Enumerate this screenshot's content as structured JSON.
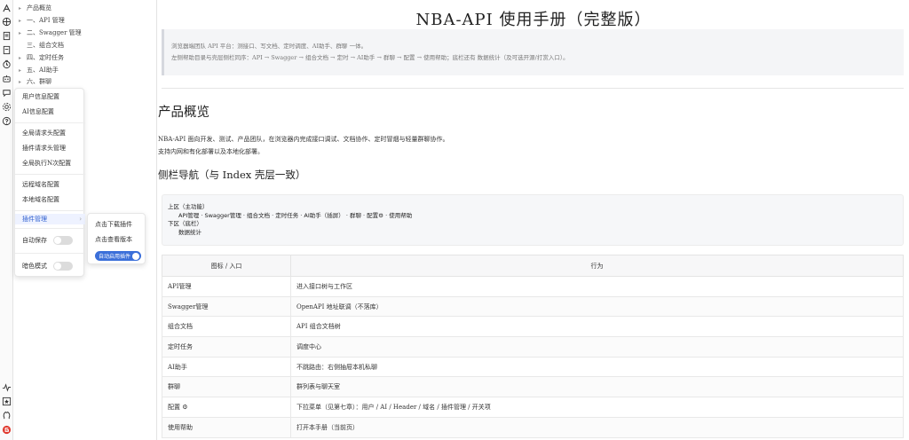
{
  "rail": {
    "top_icons": [
      "swagger-icon",
      "globe-icon",
      "document-icon",
      "docs-icon",
      "timer-icon",
      "robot-icon",
      "chat-icon",
      "gear-icon",
      "help-icon"
    ],
    "bottom_icons": [
      "pulse-icon",
      "star-icon",
      "github-icon",
      "brand-logo-icon"
    ]
  },
  "toc": {
    "items": [
      {
        "label": "产品概览",
        "bullet": "▸"
      },
      {
        "label": "一、API 管理",
        "bullet": "▸"
      },
      {
        "label": "二、Swagger 管理",
        "bullet": "▸"
      },
      {
        "label": "三、组合文档",
        "bullet": ""
      },
      {
        "label": "四、定时任务",
        "bullet": "▸"
      },
      {
        "label": "五、AI助手",
        "bullet": "▸"
      },
      {
        "label": "六、群聊",
        "bullet": "▸"
      }
    ]
  },
  "settings_menu": {
    "user_info": "用户信息配置",
    "ai_info": "AI信息配置",
    "global_header": "全局请求头配置",
    "plugin_header": "插件请求头管理",
    "global_n": "全局执行N次配置",
    "remote_domain": "远程域名配置",
    "local_domain": "本地域名配置",
    "plugin_manage": "插件管理",
    "auto_save": "自动保存",
    "dark_mode": "暗色模式"
  },
  "plugin_submenu": {
    "download": "点击下载插件",
    "version": "点击查看版本",
    "auto_enable": "自动启用插件"
  },
  "main": {
    "title": "NBA-API 使用手册（完整版）",
    "intro_line1": "浏览器端团队 API 平台：测接口、写文档、定时调度、AI助手、群聊 一体。",
    "intro_line2": "左侧帮助目录与壳层侧栏同序：API → Swagger → 组合文档 → 定时 → AI助手 → 群聊 → 配置 → 使用帮助；底栏还有 数据统计（及可选开源/打赏入口）。",
    "h2": "产品概览",
    "para_line1": "NBA-API 面向开发、测试、产品团队，在浏览器内完成接口调试、文档协作、定时冒烟与轻量群聊协作。",
    "para_line2": "支持内网和有化部署以及本地化部署。",
    "h3": "侧栏导航（与 Index 壳层一致）",
    "code_upper_label": "上区（主功能）",
    "code_upper_items": "API管理  ·  Swagger管理  ·  组合文档  ·  定时任务  ·  AI助手（插屏）  ·  群聊  ·  配置⚙  ·  使用帮助",
    "code_lower_label": "下区（底栏）",
    "code_lower_items": "数据统计"
  },
  "table": {
    "headers": [
      "图标 / 入口",
      "行为"
    ],
    "rows": [
      [
        "API管理",
        "进入接口树与工作区"
      ],
      [
        "Swagger管理",
        "OpenAPI 地址联调（不落库）"
      ],
      [
        "组合文档",
        "API 组合文档树"
      ],
      [
        "定时任务",
        "调度中心"
      ],
      [
        "AI助手",
        "不跳路由：右侧抽屉本机私聊"
      ],
      [
        "群聊",
        "群列表与聊天室"
      ],
      [
        "配置 ⚙",
        "下拉菜单（见第七章）：用户 / AI / Header / 域名 / 插件管理 / 开关项"
      ],
      [
        "使用帮助",
        "打开本手册（当前页）"
      ]
    ]
  }
}
